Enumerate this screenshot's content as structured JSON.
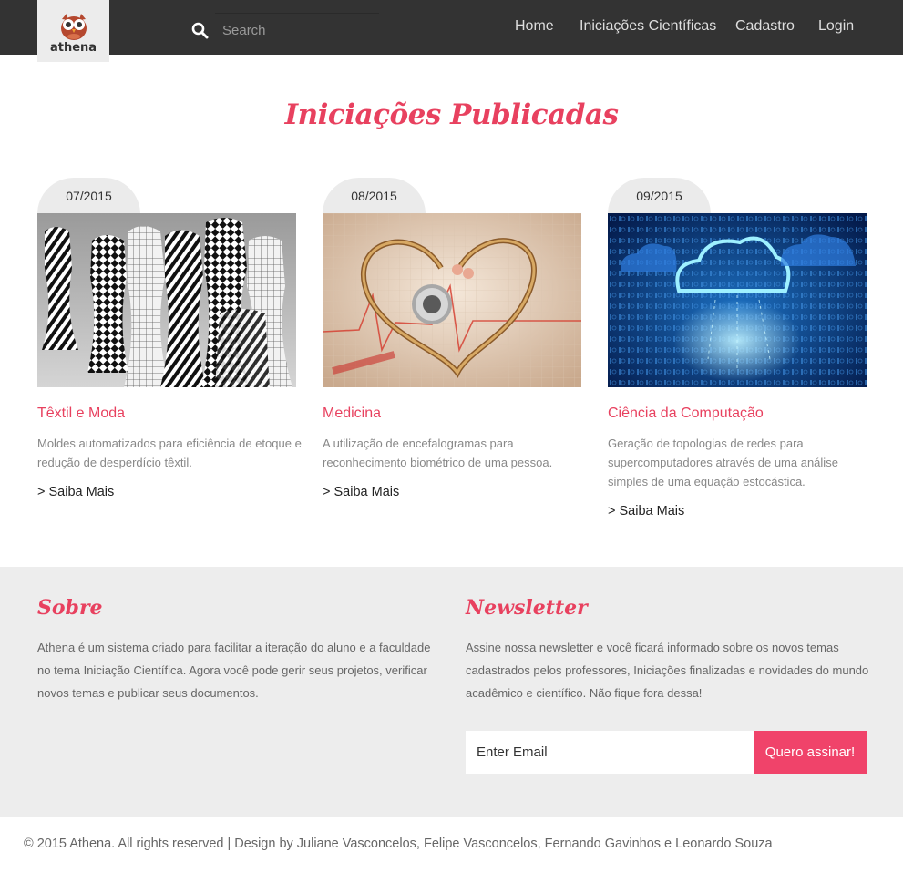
{
  "brand": {
    "name": "athena"
  },
  "search": {
    "placeholder": "Search"
  },
  "nav": {
    "home": "Home",
    "iniciacoes": "Iniciações Científicas",
    "cadastro": "Cadastro",
    "login": "Login"
  },
  "main": {
    "title": "Iniciações Publicadas",
    "cards": [
      {
        "date": "07/2015",
        "title": "Têxtil e Moda",
        "description": "Moldes automatizados para eficiência de etoque e redução de desperdício têxtil.",
        "more": "> Saiba Mais",
        "image": "mannequins-image"
      },
      {
        "date": "08/2015",
        "title": "Medicina",
        "description": "A utilização de encefalogramas para reconhecimento biométrico de uma pessoa.",
        "more": "> Saiba Mais",
        "image": "stethoscope-heart-image"
      },
      {
        "date": "09/2015",
        "title": "Ciência da Computação",
        "description": "Geração de topologias de redes para supercomputadores através de uma análise simples de uma equação estocástica.",
        "more": "> Saiba Mais",
        "image": "cloud-binary-image"
      }
    ]
  },
  "footer": {
    "about_title": "Sobre",
    "about_text": "Athena é um sistema criado para facilitar a iteração do aluno e a faculdade no tema Iniciação Científica. Agora você pode gerir seus projetos, verificar novos temas e publicar seus documentos.",
    "newsletter_title": "Newsletter",
    "newsletter_text": "Assine nossa newsletter e você ficará informado sobre os novos temas cadastrados pelos professores, Iniciações finalizadas e novidades do mundo acadêmico e científico. Não fique fora dessa!",
    "email_placeholder": "Enter Email",
    "subscribe_label": "Quero assinar!",
    "copyright": "© 2015 Athena. All rights reserved | Design by Juliane Vasconcelos, Felipe Vasconcelos, Fernando Gavinhos e Leonardo Souza"
  },
  "colors": {
    "accent": "#e8415f",
    "button": "#f0436a",
    "navbar": "#333333",
    "footer_bg": "#ededed"
  }
}
